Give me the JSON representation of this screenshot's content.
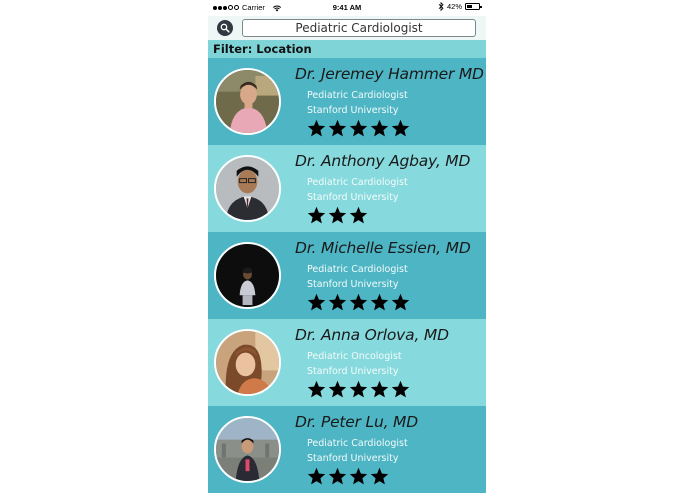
{
  "status_bar": {
    "carrier": "Carrier",
    "time": "9:41 AM",
    "battery_text": "42%",
    "battery_level": 0.42
  },
  "search": {
    "query": "Pediatric Cardiologist",
    "icon": "search-icon"
  },
  "filter": {
    "label": "Filter: Location"
  },
  "colors": {
    "card_dark": "#4db5c4",
    "card_light": "#86dadd",
    "filter_bar": "#7fd4d8",
    "search_button": "#2f3a40"
  },
  "doctors": [
    {
      "name": "Dr. Jeremey Hammer MD",
      "specialty": "Pediatric Cardiologist",
      "school": "Stanford University",
      "rating": 5,
      "avatar": "photo-man-pink-shirt"
    },
    {
      "name": "Dr. Anthony Agbay, MD",
      "specialty": "Pediatric Cardiologist",
      "school": "Stanford University",
      "rating": 3,
      "avatar": "photo-man-suit"
    },
    {
      "name": "Dr. Michelle Essien, MD",
      "specialty": "Pediatric Cardiologist",
      "school": "Stanford University",
      "rating": 5,
      "avatar": "photo-woman-dark-background"
    },
    {
      "name": "Dr. Anna Orlova, MD",
      "specialty": "Pediatric Oncologist",
      "school": "Stanford University",
      "rating": 5,
      "avatar": "photo-woman-long-hair"
    },
    {
      "name": "Dr. Peter Lu, MD",
      "specialty": "Pediatric Cardiologist",
      "school": "Stanford University",
      "rating": 4,
      "avatar": "photo-man-outdoors"
    }
  ]
}
